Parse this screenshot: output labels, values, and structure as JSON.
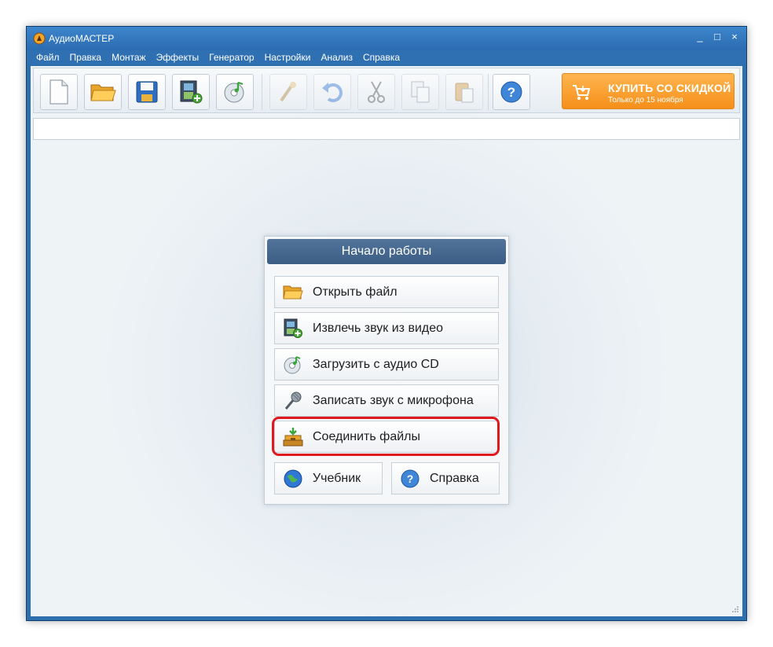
{
  "window": {
    "title": "АудиоМАСТЕР",
    "controls": [
      "_",
      "□",
      "×"
    ]
  },
  "menu": [
    "Файл",
    "Правка",
    "Монтаж",
    "Эффекты",
    "Генератор",
    "Настройки",
    "Анализ",
    "Справка"
  ],
  "toolbar": {
    "buttons": [
      {
        "name": "new-file",
        "icon": "new-document-icon",
        "enabled": true
      },
      {
        "name": "open-file",
        "icon": "open-folder-icon",
        "enabled": true
      },
      {
        "name": "save-file",
        "icon": "save-disk-icon",
        "enabled": true
      },
      {
        "name": "extract-video",
        "icon": "film-add-icon",
        "enabled": true
      },
      {
        "name": "load-cd",
        "icon": "cd-music-icon",
        "enabled": true
      },
      {
        "name": "effect",
        "icon": "wand-icon",
        "enabled": false
      },
      {
        "name": "undo",
        "icon": "undo-icon",
        "enabled": false
      },
      {
        "name": "cut",
        "icon": "scissors-icon",
        "enabled": false
      },
      {
        "name": "copy",
        "icon": "copy-icon",
        "enabled": false
      },
      {
        "name": "paste",
        "icon": "paste-icon",
        "enabled": false
      },
      {
        "name": "help",
        "icon": "help-icon",
        "enabled": true
      }
    ],
    "buy": {
      "title": "КУПИТЬ СО СКИДКОЙ",
      "subtitle": "Только до 15 ноября"
    }
  },
  "start_panel": {
    "title": "Начало работы",
    "items": [
      {
        "label": "Открыть файл",
        "icon": "open-folder-icon"
      },
      {
        "label": "Извлечь звук из видео",
        "icon": "film-add-icon"
      },
      {
        "label": "Загрузить с аудио CD",
        "icon": "cd-music-icon"
      },
      {
        "label": "Записать звук с микрофона",
        "icon": "microphone-icon"
      },
      {
        "label": "Соединить файлы",
        "icon": "join-files-icon",
        "highlighted": true
      }
    ],
    "bottom": [
      {
        "label": "Учебник",
        "icon": "globe-icon"
      },
      {
        "label": "Справка",
        "icon": "help-icon"
      }
    ]
  },
  "colors": {
    "accent": "#2e6fae",
    "highlight": "#e0191e",
    "buy": "#f68f1a",
    "panel_header": "#466790"
  }
}
